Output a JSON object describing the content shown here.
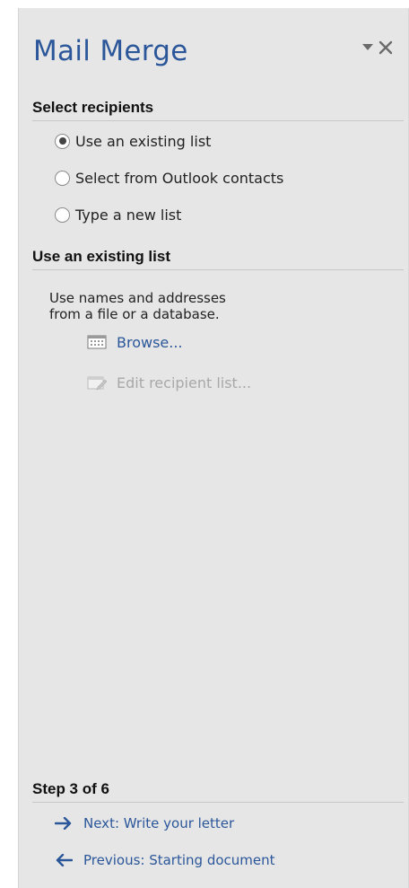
{
  "pane": {
    "title": "Mail Merge",
    "accent_color": "#2b579a",
    "dropdown_icon": "triangle-down-icon",
    "close_icon": "close-icon"
  },
  "select_recipients": {
    "header": "Select recipients",
    "options": [
      {
        "label": "Use an existing list",
        "selected": true
      },
      {
        "label": "Select from Outlook contacts",
        "selected": false
      },
      {
        "label": "Type a new list",
        "selected": false
      }
    ]
  },
  "use_existing": {
    "header": "Use an existing list",
    "description_line1": "Use names and addresses",
    "description_line2": "from a file or a database.",
    "browse_label": "Browse...",
    "edit_label": "Edit recipient list..."
  },
  "step": {
    "header": "Step 3 of 6",
    "next_label": "Next: Write your letter",
    "previous_label": "Previous: Starting document"
  }
}
